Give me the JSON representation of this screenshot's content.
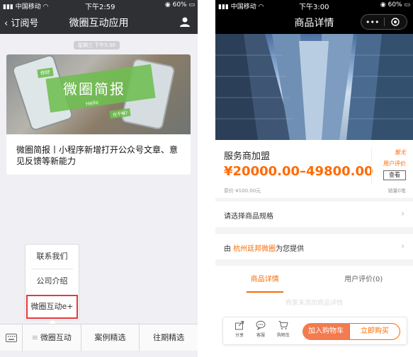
{
  "left": {
    "status": {
      "carrier": "中国移动",
      "time": "下午2:59",
      "battery": "60%"
    },
    "nav": {
      "back_label": "订阅号",
      "title": "微圈互动应用"
    },
    "chat": {
      "timestamp": "星期三 下午5:30",
      "article": {
        "image_banner": "微圈简报",
        "image_tags": [
          "你好",
          "Hello",
          "在干嘛?"
        ],
        "title": "微圈简报丨小程序新增打开公众号文章、意见反馈等新能力"
      }
    },
    "popup_menu": {
      "items": [
        "联系我们",
        "公司介绍",
        "微圈互动e+"
      ],
      "selected_index": 2
    },
    "bottom_menu": {
      "items": [
        "微圈互动",
        "案例精选",
        "往期精选"
      ]
    }
  },
  "right": {
    "status": {
      "carrier": "中国移动",
      "time": "下午3:00",
      "battery": "60%"
    },
    "nav": {
      "title": "商品详情",
      "capsule_more": "•••"
    },
    "product": {
      "name": "服务商加盟",
      "price": "¥20000.00–49800.00",
      "original_price": "原价 ¥100.00元",
      "rating_none": "暂无",
      "rating_label": "用户评价",
      "view_button": "查看",
      "sales": "销量0笔"
    },
    "spec_row": {
      "label": "请选择商品规格"
    },
    "provider_row": {
      "prefix": "由 ",
      "provider": "杭州廷邦微圈",
      "suffix": "为您提供"
    },
    "tabs": [
      {
        "label": "商品详情",
        "active": true
      },
      {
        "label": "用户评价(0)",
        "active": false
      }
    ],
    "detail_ghost_text": "商家未添加商品详情",
    "action_bar": {
      "icons": [
        {
          "label": "分享",
          "icon": "share-icon"
        },
        {
          "label": "客服",
          "icon": "chat-icon"
        },
        {
          "label": "购物车",
          "icon": "cart-icon"
        }
      ],
      "add_to_cart": "加入购物车",
      "buy_now": "立即购买"
    },
    "accent_color": "#ff6a00"
  }
}
